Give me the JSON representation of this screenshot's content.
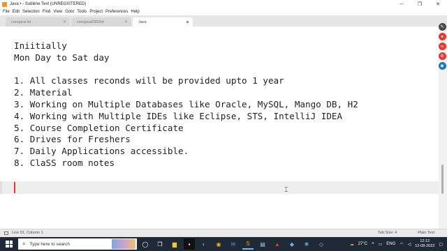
{
  "window": {
    "title": "Java • - Sublime Text (UNREGISTERED)",
    "controls": [
      "─",
      "❐",
      "✕"
    ]
  },
  "menu": [
    "File",
    "Edit",
    "Selection",
    "Find",
    "View",
    "Goto",
    "Tools",
    "Project",
    "Preferences",
    "Help"
  ],
  "tabs": [
    {
      "label": "corejava.txt",
      "close": "✕"
    },
    {
      "label": "corejava0302txt",
      "close": "✕"
    },
    {
      "label": "Java",
      "active": true,
      "modified": true
    }
  ],
  "editor": {
    "lines": [
      "Iniitially",
      "Mon Day to Sat day",
      "",
      "1. All classes reconds will be provided upto 1 year",
      "2. Material",
      "3. Working on Multiple Databases like Oracle, MySQL, Mango DB, H2",
      "4. Working with Multiple IDEs like Eclipse, STS, IntelliJ IDEA",
      "5. Course Completion Certificate",
      "6. Drives for Freshers",
      "7. Daily Applications accessible.",
      "8. ClaSS room notes"
    ],
    "caret_color": "#e53935"
  },
  "status": {
    "position": "Line 91, Column 1",
    "tab_size": "Tab Size: 4",
    "syntax": "Plain Text"
  },
  "side_icons": [
    {
      "name": "edit-icon",
      "glyph": "✎",
      "color": "#4a4a4a"
    },
    {
      "name": "record-icon",
      "glyph": "●",
      "color": "#e53935"
    },
    {
      "name": "link-icon",
      "glyph": "∞",
      "color": "#e53935"
    },
    {
      "name": "share-icon",
      "glyph": "⚙",
      "color": "#e53935"
    },
    {
      "name": "camera-icon",
      "glyph": "◉",
      "color": "#1e73be"
    }
  ],
  "taskbar": {
    "search_placeholder": "Type here to search",
    "weather": "27°C",
    "language": "ENG",
    "time": "12:12",
    "date": "12-08-2022",
    "accent": "#1f2a36"
  }
}
